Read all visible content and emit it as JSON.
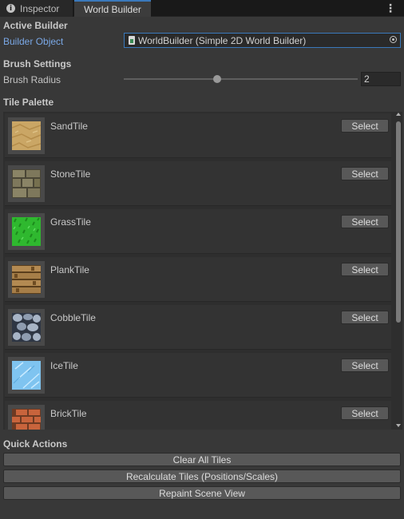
{
  "tabs": [
    {
      "label": "Inspector",
      "icon": "info-icon"
    },
    {
      "label": "World Builder"
    }
  ],
  "sections": {
    "active_builder": "Active Builder",
    "brush_settings": "Brush Settings",
    "tile_palette": "Tile Palette",
    "quick_actions": "Quick Actions"
  },
  "builder_object": {
    "label": "Builder Object",
    "value": "WorldBuilder (Simple 2D World Builder)"
  },
  "brush": {
    "label": "Brush Radius",
    "value": "2",
    "slider_fraction": 0.4
  },
  "tiles": [
    {
      "name": "SandTile",
      "button": "Select",
      "icon": "sand-texture-icon"
    },
    {
      "name": "StoneTile",
      "button": "Select",
      "icon": "stone-texture-icon"
    },
    {
      "name": "GrassTile",
      "button": "Select",
      "icon": "grass-texture-icon"
    },
    {
      "name": "PlankTile",
      "button": "Select",
      "icon": "plank-texture-icon"
    },
    {
      "name": "CobbleTile",
      "button": "Select",
      "icon": "cobble-texture-icon"
    },
    {
      "name": "IceTile",
      "button": "Select",
      "icon": "ice-texture-icon"
    },
    {
      "name": "BrickTile",
      "button": "Select",
      "icon": "brick-texture-icon"
    }
  ],
  "actions": {
    "clear": "Clear All Tiles",
    "recalc": "Recalculate Tiles (Positions/Scales)",
    "repaint": "Repaint Scene View"
  },
  "colors": {
    "background": "#383838",
    "accent": "#3a79bb",
    "link_label": "#7aa8e6"
  }
}
